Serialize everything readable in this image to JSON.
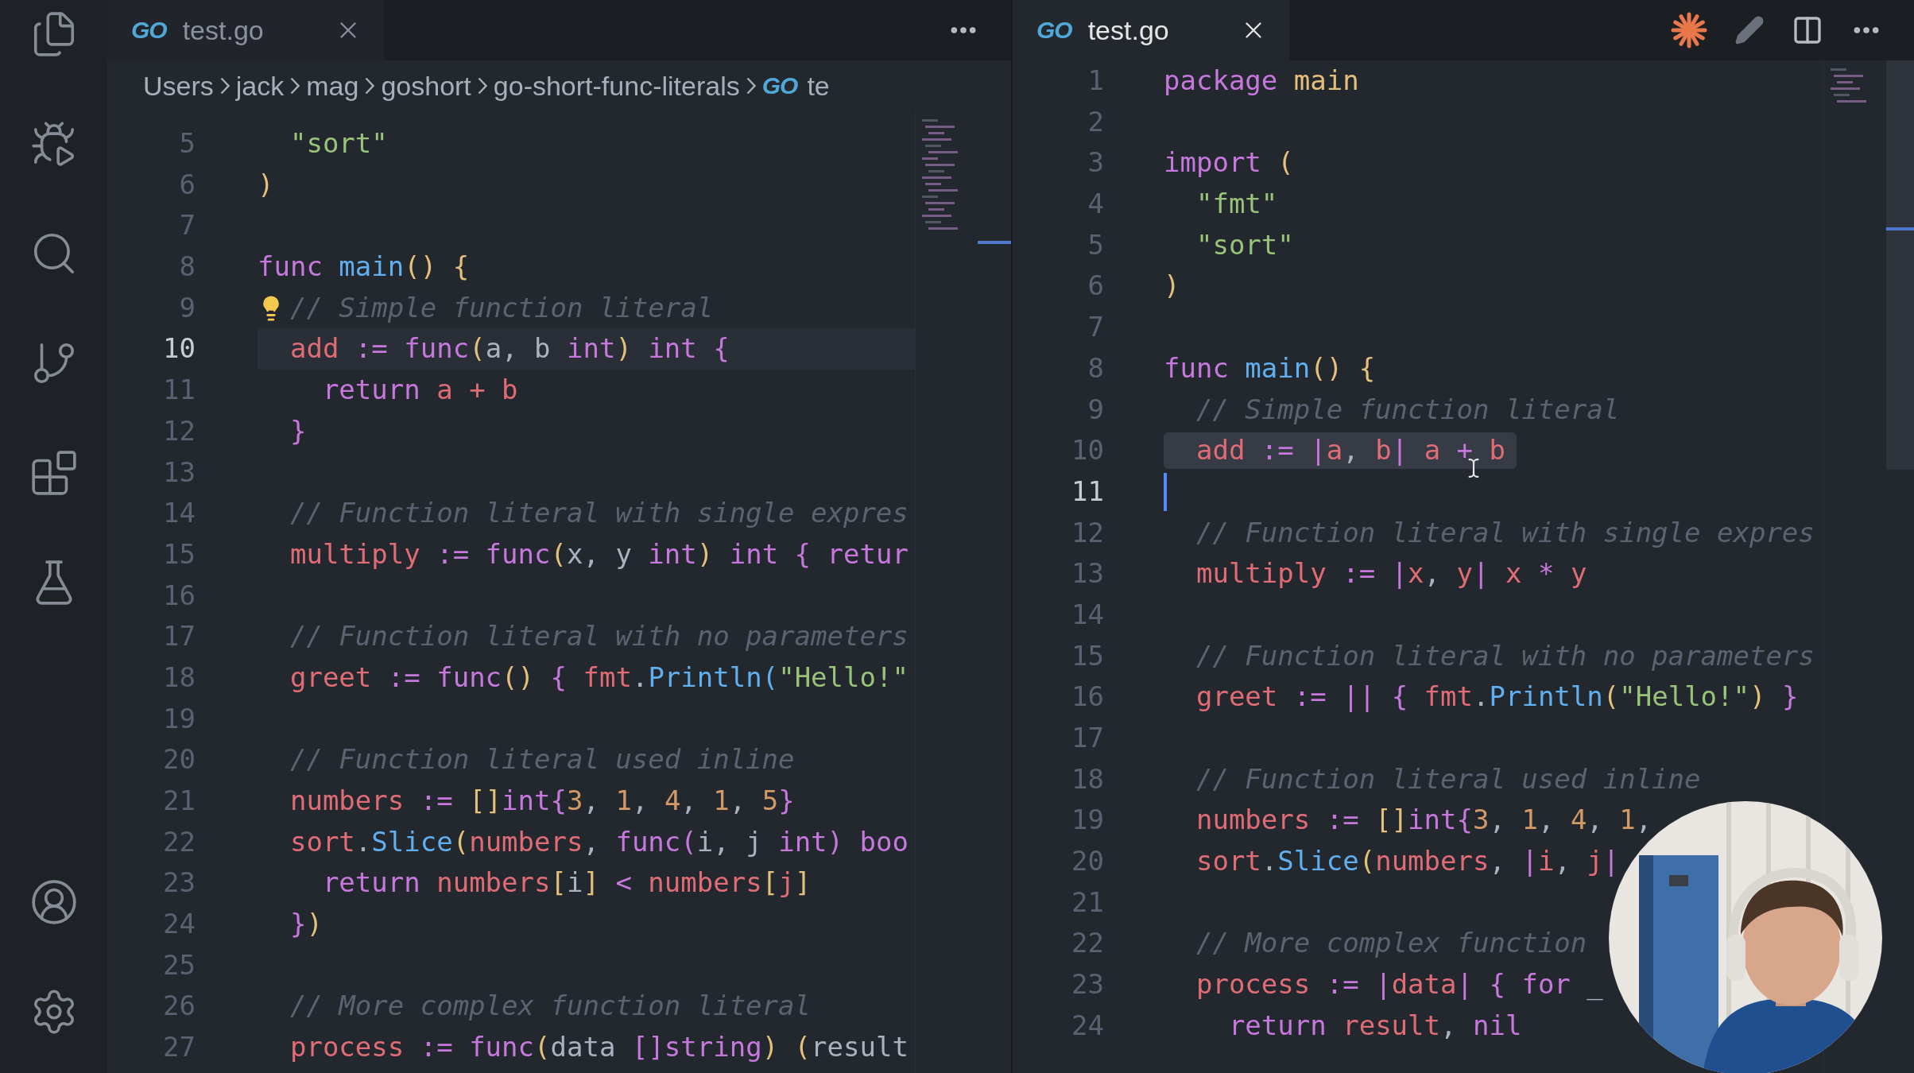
{
  "activity_bar": {
    "top": [
      {
        "kind": "files"
      },
      {
        "kind": "run_debug"
      },
      {
        "kind": "search"
      },
      {
        "kind": "source_control"
      },
      {
        "kind": "extensions"
      },
      {
        "kind": "testing"
      }
    ],
    "bottom": [
      {
        "kind": "account"
      },
      {
        "kind": "settings"
      }
    ]
  },
  "editors": [
    {
      "tab": {
        "icon": "GO",
        "title": "test.go",
        "active": false
      },
      "actions": [
        {
          "kind": "more"
        }
      ],
      "breadcrumb": [
        {
          "label": "Users"
        },
        {
          "label": "jack"
        },
        {
          "label": "mag"
        },
        {
          "label": "goshort"
        },
        {
          "label": "go-short-func-literals"
        },
        {
          "label": "te",
          "icon": "GO"
        }
      ],
      "lines": [
        {
          "n": "5",
          "current": false,
          "highlighted": false,
          "tokens": [
            {
              "text": "  \"sort\"",
              "kind": "str"
            }
          ]
        },
        {
          "n": "6",
          "current": false,
          "highlighted": false,
          "tokens": [
            {
              "text": ")",
              "kind": "y"
            }
          ]
        },
        {
          "n": "7",
          "current": false,
          "highlighted": false
        },
        {
          "n": "8",
          "current": false,
          "highlighted": false,
          "tokens": [
            {
              "text": "func",
              "kind": "kw"
            },
            {
              "text": " main",
              "kind": "fn"
            },
            {
              "text": "()",
              "kind": "y"
            },
            {
              "text": " {",
              "kind": "y"
            }
          ]
        },
        {
          "n": "9",
          "current": false,
          "highlighted": false,
          "tokens": [
            {
              "kind": "bulb"
            },
            {
              "text": "  // Simple function literal",
              "kind": "cm"
            }
          ]
        },
        {
          "n": "10",
          "current": true,
          "highlighted": false,
          "tokens": [
            {
              "text": "  add",
              "kind": "var"
            },
            {
              "text": " :=",
              "kind": "kw"
            },
            {
              "text": " func",
              "kind": "kw"
            },
            {
              "text": "(",
              "kind": "y"
            },
            {
              "text": "a, b",
              "kind": "op"
            },
            {
              "text": " int",
              "kind": "kw"
            },
            {
              "text": ")",
              "kind": "y"
            },
            {
              "text": " int",
              "kind": "kw"
            },
            {
              "text": " {",
              "kind": "p"
            }
          ]
        },
        {
          "n": "11",
          "current": false,
          "highlighted": false,
          "tokens": [
            {
              "text": "    return",
              "kind": "kw"
            },
            {
              "text": " a + b",
              "kind": "var"
            }
          ]
        },
        {
          "n": "12",
          "current": false,
          "highlighted": false,
          "tokens": [
            {
              "text": "  }",
              "kind": "p"
            }
          ]
        },
        {
          "n": "13",
          "current": false,
          "highlighted": false
        },
        {
          "n": "14",
          "current": false,
          "highlighted": false,
          "tokens": [
            {
              "text": "  // Function literal with single expres",
              "kind": "cm"
            }
          ]
        },
        {
          "n": "15",
          "current": false,
          "highlighted": false,
          "tokens": [
            {
              "text": "  multiply",
              "kind": "var"
            },
            {
              "text": " :=",
              "kind": "kw"
            },
            {
              "text": " func",
              "kind": "kw"
            },
            {
              "text": "(",
              "kind": "y"
            },
            {
              "text": "x, y",
              "kind": "op"
            },
            {
              "text": " int",
              "kind": "kw"
            },
            {
              "text": ")",
              "kind": "y"
            },
            {
              "text": " int",
              "kind": "kw"
            },
            {
              "text": " {",
              "kind": "p"
            },
            {
              "text": " retur",
              "kind": "kw"
            }
          ]
        },
        {
          "n": "16",
          "current": false,
          "highlighted": false
        },
        {
          "n": "17",
          "current": false,
          "highlighted": false,
          "tokens": [
            {
              "text": "  // Function literal with no parameters",
              "kind": "cm"
            }
          ]
        },
        {
          "n": "18",
          "current": false,
          "highlighted": false,
          "tokens": [
            {
              "text": "  greet",
              "kind": "var"
            },
            {
              "text": " :=",
              "kind": "kw"
            },
            {
              "text": " func",
              "kind": "kw"
            },
            {
              "text": "()",
              "kind": "y"
            },
            {
              "text": " {",
              "kind": "p"
            },
            {
              "text": " fmt",
              "kind": "var"
            },
            {
              "text": ".",
              "kind": "op"
            },
            {
              "text": "Println",
              "kind": "fn"
            },
            {
              "text": "(",
              "kind": "b"
            },
            {
              "text": "\"Hello!\"",
              "kind": "str"
            }
          ]
        },
        {
          "n": "19",
          "current": false,
          "highlighted": false
        },
        {
          "n": "20",
          "current": false,
          "highlighted": false,
          "tokens": [
            {
              "text": "  // Function literal used inline",
              "kind": "cm"
            }
          ]
        },
        {
          "n": "21",
          "current": false,
          "highlighted": false,
          "tokens": [
            {
              "text": "  numbers",
              "kind": "var"
            },
            {
              "text": " :=",
              "kind": "kw"
            },
            {
              "text": " []",
              "kind": "y"
            },
            {
              "text": "int",
              "kind": "kw"
            },
            {
              "text": "{",
              "kind": "p"
            },
            {
              "text": "3",
              "kind": "num"
            },
            {
              "text": ",",
              "kind": "op"
            },
            {
              "text": " 1",
              "kind": "num"
            },
            {
              "text": ",",
              "kind": "op"
            },
            {
              "text": " 4",
              "kind": "num"
            },
            {
              "text": ",",
              "kind": "op"
            },
            {
              "text": " 1",
              "kind": "num"
            },
            {
              "text": ",",
              "kind": "op"
            },
            {
              "text": " 5",
              "kind": "num"
            },
            {
              "text": "}",
              "kind": "p"
            }
          ]
        },
        {
          "n": "22",
          "current": false,
          "highlighted": false,
          "tokens": [
            {
              "text": "  sort",
              "kind": "var"
            },
            {
              "text": ".",
              "kind": "op"
            },
            {
              "text": "Slice",
              "kind": "fn"
            },
            {
              "text": "(",
              "kind": "y"
            },
            {
              "text": "numbers",
              "kind": "var"
            },
            {
              "text": ",",
              "kind": "op"
            },
            {
              "text": " func",
              "kind": "kw"
            },
            {
              "text": "(",
              "kind": "p"
            },
            {
              "text": "i, j",
              "kind": "op"
            },
            {
              "text": " int",
              "kind": "kw"
            },
            {
              "text": ")",
              "kind": "p"
            },
            {
              "text": " boo",
              "kind": "kw"
            }
          ]
        },
        {
          "n": "23",
          "current": false,
          "highlighted": false,
          "tokens": [
            {
              "text": "    return",
              "kind": "kw"
            },
            {
              "text": " numbers",
              "kind": "var"
            },
            {
              "text": "[",
              "kind": "y"
            },
            {
              "text": "i",
              "kind": "op"
            },
            {
              "text": "]",
              "kind": "y"
            },
            {
              "text": " <",
              "kind": "kw"
            },
            {
              "text": " numbers",
              "kind": "var"
            },
            {
              "text": "[",
              "kind": "y"
            },
            {
              "text": "j",
              "kind": "var"
            },
            {
              "text": "]",
              "kind": "y"
            }
          ]
        },
        {
          "n": "24",
          "current": false,
          "highlighted": false,
          "tokens": [
            {
              "text": "  }",
              "kind": "p"
            },
            {
              "text": ")",
              "kind": "y"
            }
          ]
        },
        {
          "n": "25",
          "current": false,
          "highlighted": false
        },
        {
          "n": "26",
          "current": false,
          "highlighted": false,
          "tokens": [
            {
              "text": "  // More complex function literal",
              "kind": "cm"
            }
          ]
        },
        {
          "n": "27",
          "current": false,
          "highlighted": false,
          "tokens": [
            {
              "text": "  process",
              "kind": "var"
            },
            {
              "text": " :=",
              "kind": "kw"
            },
            {
              "text": " func",
              "kind": "kw"
            },
            {
              "text": "(",
              "kind": "y"
            },
            {
              "text": "data",
              "kind": "op"
            },
            {
              "text": " []",
              "kind": "p"
            },
            {
              "text": "string",
              "kind": "kw"
            },
            {
              "text": ")",
              "kind": "y"
            },
            {
              "text": " (",
              "kind": "y"
            },
            {
              "text": "result",
              "kind": "op"
            }
          ]
        }
      ]
    },
    {
      "tab": {
        "icon": "GO",
        "title": "test.go",
        "active": true
      },
      "actions": [
        {
          "kind": "sparkle"
        },
        {
          "kind": "edit"
        },
        {
          "kind": "split"
        },
        {
          "kind": "more"
        }
      ],
      "lines": [
        {
          "n": "1",
          "current": false,
          "highlighted": false,
          "tokens": [
            {
              "text": "package",
              "kind": "kw"
            },
            {
              "text": " main",
              "kind": "ty"
            }
          ]
        },
        {
          "n": "2",
          "current": false,
          "highlighted": false
        },
        {
          "n": "3",
          "current": false,
          "highlighted": false,
          "tokens": [
            {
              "text": "import",
              "kind": "kw"
            },
            {
              "text": " (",
              "kind": "y"
            }
          ]
        },
        {
          "n": "4",
          "current": false,
          "highlighted": false,
          "tokens": [
            {
              "text": "  \"fmt\"",
              "kind": "str"
            }
          ]
        },
        {
          "n": "5",
          "current": false,
          "highlighted": false,
          "tokens": [
            {
              "text": "  \"sort\"",
              "kind": "str"
            }
          ]
        },
        {
          "n": "6",
          "current": false,
          "highlighted": false,
          "tokens": [
            {
              "text": ")",
              "kind": "y"
            }
          ]
        },
        {
          "n": "7",
          "current": false,
          "highlighted": false
        },
        {
          "n": "8",
          "current": false,
          "highlighted": false,
          "tokens": [
            {
              "text": "func",
              "kind": "kw"
            },
            {
              "text": " main",
              "kind": "fn"
            },
            {
              "text": "()",
              "kind": "y"
            },
            {
              "text": " {",
              "kind": "y"
            }
          ]
        },
        {
          "n": "9",
          "current": false,
          "highlighted": false,
          "tokens": [
            {
              "text": "  // Simple function literal",
              "kind": "cm"
            }
          ]
        },
        {
          "n": "10",
          "current": false,
          "highlighted": true,
          "tokens": [
            {
              "text": "  add",
              "kind": "var"
            },
            {
              "text": " :=",
              "kind": "kw"
            },
            {
              "text": " |",
              "kind": "p"
            },
            {
              "text": "a",
              "kind": "var"
            },
            {
              "text": ",",
              "kind": "op"
            },
            {
              "text": " b",
              "kind": "var"
            },
            {
              "text": "|",
              "kind": "p"
            },
            {
              "text": " a",
              "kind": "var"
            },
            {
              "text": " +",
              "kind": "kw"
            },
            {
              "kind": "mouse"
            },
            {
              "text": " b",
              "kind": "var"
            }
          ]
        },
        {
          "n": "11",
          "current": true,
          "highlighted": false,
          "tokens": [
            {
              "kind": "caret"
            }
          ]
        },
        {
          "n": "12",
          "current": false,
          "highlighted": false,
          "tokens": [
            {
              "text": "  // Function literal with single expres",
              "kind": "cm"
            }
          ]
        },
        {
          "n": "13",
          "current": false,
          "highlighted": false,
          "tokens": [
            {
              "text": "  multiply",
              "kind": "var"
            },
            {
              "text": " :=",
              "kind": "kw"
            },
            {
              "text": " |",
              "kind": "p"
            },
            {
              "text": "x",
              "kind": "var"
            },
            {
              "text": ",",
              "kind": "op"
            },
            {
              "text": " y",
              "kind": "var"
            },
            {
              "text": "|",
              "kind": "p"
            },
            {
              "text": " x",
              "kind": "var"
            },
            {
              "text": " *",
              "kind": "kw"
            },
            {
              "text": " y",
              "kind": "var"
            }
          ]
        },
        {
          "n": "14",
          "current": false,
          "highlighted": false
        },
        {
          "n": "15",
          "current": false,
          "highlighted": false,
          "tokens": [
            {
              "text": "  // Function literal with no parameters",
              "kind": "cm"
            }
          ]
        },
        {
          "n": "16",
          "current": false,
          "highlighted": false,
          "tokens": [
            {
              "text": "  greet",
              "kind": "var"
            },
            {
              "text": " :=",
              "kind": "kw"
            },
            {
              "text": " ||",
              "kind": "p"
            },
            {
              "text": " {",
              "kind": "p"
            },
            {
              "text": " fmt",
              "kind": "var"
            },
            {
              "text": ".",
              "kind": "op"
            },
            {
              "text": "Println",
              "kind": "fn"
            },
            {
              "text": "(",
              "kind": "y"
            },
            {
              "text": "\"Hello!\"",
              "kind": "str"
            },
            {
              "text": ")",
              "kind": "y"
            },
            {
              "text": " }",
              "kind": "p"
            }
          ]
        },
        {
          "n": "17",
          "current": false,
          "highlighted": false
        },
        {
          "n": "18",
          "current": false,
          "highlighted": false,
          "tokens": [
            {
              "text": "  // Function literal used inline",
              "kind": "cm"
            }
          ]
        },
        {
          "n": "19",
          "current": false,
          "highlighted": false,
          "tokens": [
            {
              "text": "  numbers",
              "kind": "var"
            },
            {
              "text": " :=",
              "kind": "kw"
            },
            {
              "text": " []",
              "kind": "y"
            },
            {
              "text": "int",
              "kind": "kw"
            },
            {
              "text": "{",
              "kind": "p"
            },
            {
              "text": "3",
              "kind": "num"
            },
            {
              "text": ",",
              "kind": "op"
            },
            {
              "text": " 1",
              "kind": "num"
            },
            {
              "text": ",",
              "kind": "op"
            },
            {
              "text": " 4",
              "kind": "num"
            },
            {
              "text": ",",
              "kind": "op"
            },
            {
              "text": " 1",
              "kind": "num"
            },
            {
              "text": ",",
              "kind": "op"
            }
          ]
        },
        {
          "n": "20",
          "current": false,
          "highlighted": false,
          "tokens": [
            {
              "text": "  sort",
              "kind": "var"
            },
            {
              "text": ".",
              "kind": "op"
            },
            {
              "text": "Slice",
              "kind": "fn"
            },
            {
              "text": "(",
              "kind": "y"
            },
            {
              "text": "numbers",
              "kind": "var"
            },
            {
              "text": ",",
              "kind": "op"
            },
            {
              "text": " |",
              "kind": "p"
            },
            {
              "text": "i",
              "kind": "var"
            },
            {
              "text": ",",
              "kind": "op"
            },
            {
              "text": " j",
              "kind": "var"
            },
            {
              "text": "|",
              "kind": "p"
            }
          ]
        },
        {
          "n": "21",
          "current": false,
          "highlighted": false
        },
        {
          "n": "22",
          "current": false,
          "highlighted": false,
          "tokens": [
            {
              "text": "  // More complex function",
              "kind": "cm"
            }
          ]
        },
        {
          "n": "23",
          "current": false,
          "highlighted": false,
          "tokens": [
            {
              "text": "  process",
              "kind": "var"
            },
            {
              "text": " :=",
              "kind": "kw"
            },
            {
              "text": " |",
              "kind": "p"
            },
            {
              "text": "data",
              "kind": "var"
            },
            {
              "text": "|",
              "kind": "p"
            },
            {
              "text": " {",
              "kind": "p"
            },
            {
              "text": " for",
              "kind": "kw"
            },
            {
              "text": " _",
              "kind": "op"
            }
          ]
        },
        {
          "n": "24",
          "current": false,
          "highlighted": false,
          "tokens": [
            {
              "text": "    return",
              "kind": "kw"
            },
            {
              "text": " result",
              "kind": "var"
            },
            {
              "text": ",",
              "kind": "op"
            },
            {
              "text": " nil",
              "kind": "kw"
            }
          ]
        }
      ]
    }
  ]
}
